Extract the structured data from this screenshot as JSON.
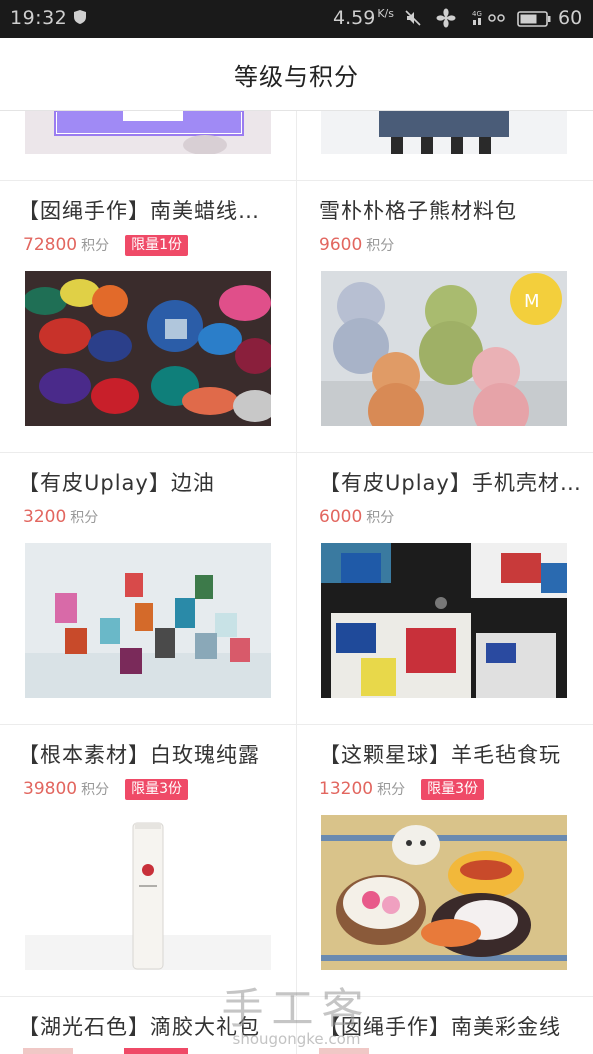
{
  "status_bar": {
    "time": "19:32",
    "speed": "4.59",
    "speed_unit": "K/s",
    "battery": "60"
  },
  "header": {
    "title": "等级与积分"
  },
  "products": [
    {
      "name": "",
      "points": "",
      "unit": "",
      "limit": ""
    },
    {
      "name": "",
      "points": "",
      "unit": "",
      "limit": ""
    },
    {
      "name": "【囡绳手作】南美蜡线…",
      "points": "72800",
      "unit": "积分",
      "limit": "限量1份"
    },
    {
      "name": "雪朴朴格子熊材料包",
      "points": "9600",
      "unit": "积分",
      "limit": ""
    },
    {
      "name": "【有皮Uplay】边油",
      "points": "3200",
      "unit": "积分",
      "limit": ""
    },
    {
      "name": "【有皮Uplay】手机壳材…",
      "points": "6000",
      "unit": "积分",
      "limit": ""
    },
    {
      "name": "【根本素材】白玫瑰纯露",
      "points": "39800",
      "unit": "积分",
      "limit": "限量3份"
    },
    {
      "name": "【这颗星球】羊毛毡食玩",
      "points": "13200",
      "unit": "积分",
      "limit": "限量3份"
    },
    {
      "name": "【湖光石色】滴胶大礼包",
      "points": "",
      "unit": "",
      "limit": ""
    },
    {
      "name": "【囡绳手作】南美彩金线",
      "points": "",
      "unit": "",
      "limit": ""
    }
  ],
  "watermark": {
    "text": "手工客",
    "url": "shougongke.com"
  },
  "colors": {
    "points": "#e2665f",
    "limit_badge": "#ef4a67",
    "status_bar": "#1a1a1a"
  }
}
